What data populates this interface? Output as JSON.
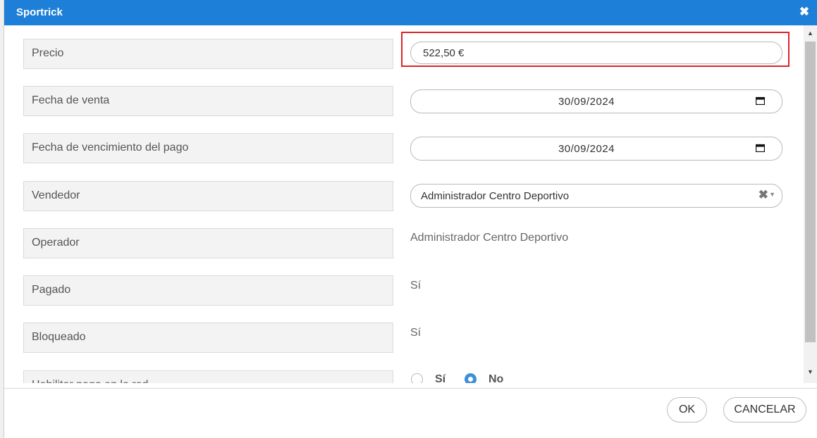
{
  "window": {
    "title": "Sportrick",
    "close_glyph": "✖"
  },
  "fields": {
    "precio": {
      "label": "Precio",
      "value": "522,50 €"
    },
    "fecha_venta": {
      "label": "Fecha de venta",
      "value": "30/09/2024"
    },
    "fecha_vencimiento": {
      "label": "Fecha de vencimiento del pago",
      "value": "30/09/2024"
    },
    "vendedor": {
      "label": "Vendedor",
      "value": "Administrador Centro Deportivo",
      "clear_glyph": "✖",
      "arrow_glyph": "▼"
    },
    "operador": {
      "label": "Operador",
      "value": "Administrador Centro Deportivo"
    },
    "pagado": {
      "label": "Pagado",
      "value": "Sí"
    },
    "bloqueado": {
      "label": "Bloqueado",
      "value": "Sí"
    },
    "habilitar_pago": {
      "label": "Habilitar pago en la red",
      "options": [
        "Sí",
        "No"
      ],
      "selected": "No"
    }
  },
  "scrollbar": {
    "up_glyph": "▲",
    "down_glyph": "▼"
  },
  "buttons": {
    "ok": "OK",
    "cancel": "CANCELAR"
  },
  "colors": {
    "titlebar": "#1e7fd8",
    "highlight": "#d9242b",
    "radio_selected": "#3e8fd8"
  }
}
